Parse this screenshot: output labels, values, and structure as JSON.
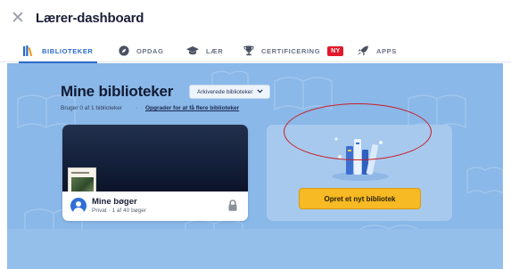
{
  "window": {
    "title": "Lærer-dashboard"
  },
  "nav": {
    "tabs": [
      {
        "label": "BIBLIOTEKER",
        "icon": "library-icon",
        "active": true
      },
      {
        "label": "OPDAG",
        "icon": "compass-icon",
        "active": false
      },
      {
        "label": "LÆR",
        "icon": "graduation-cap-icon",
        "active": false
      },
      {
        "label": "CERTIFICERING",
        "icon": "trophy-icon",
        "active": false,
        "badge": "NY"
      },
      {
        "label": "APPS",
        "icon": "rocket-icon",
        "active": false
      }
    ]
  },
  "main": {
    "title": "Mine biblioteker",
    "archive_button": "Arkiverede biblioteker",
    "usage": "Bruger 0 af 1 biblioteker",
    "separator": "·",
    "upgrade_link": "Opgrader for at få flere biblioteker"
  },
  "library_card": {
    "name": "Mine bøger",
    "meta": "Privat · 1 af 40 bøger"
  },
  "create_panel": {
    "button_label": "Opret et nyt bibliotek"
  },
  "colors": {
    "accent": "#2c69c9",
    "background": "#8ab8e8",
    "create_button": "#f7b924",
    "badge": "#e2192b",
    "annotation": "#c81d25"
  }
}
